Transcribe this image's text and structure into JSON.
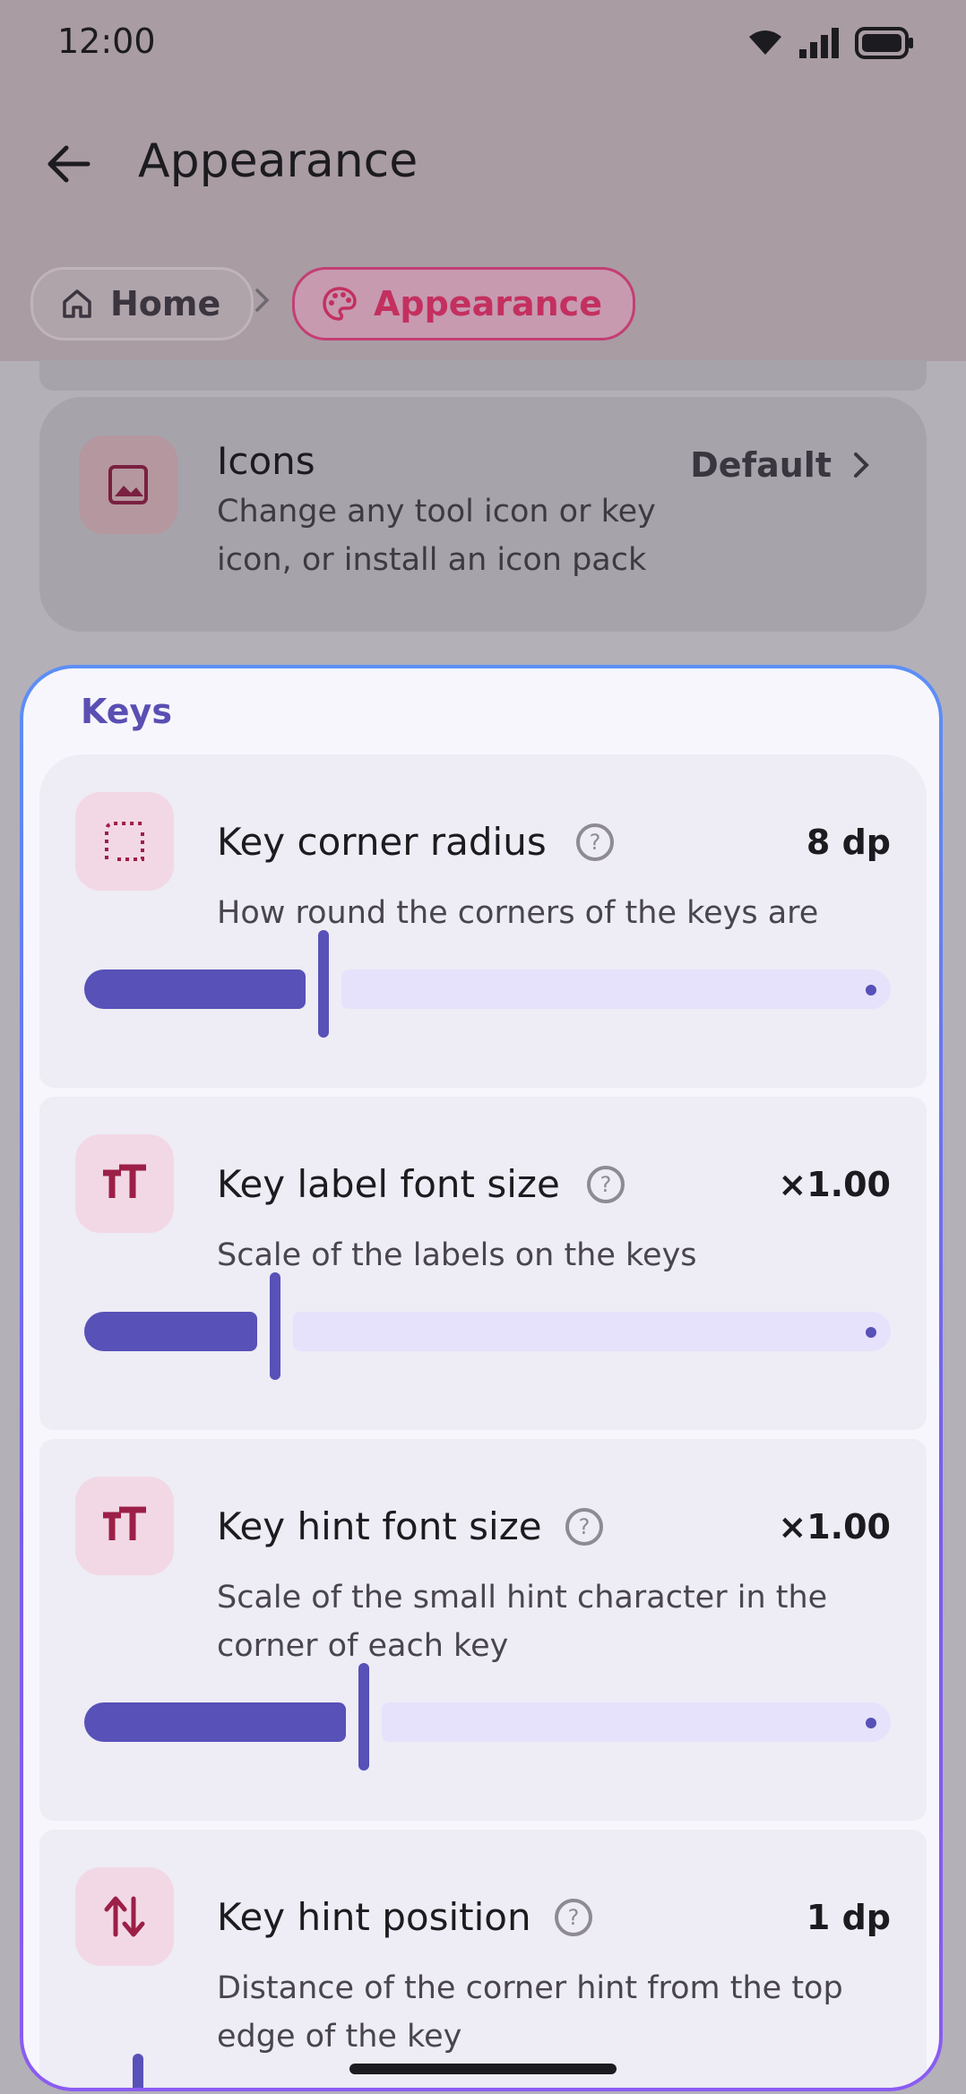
{
  "status_bar": {
    "time": "12:00"
  },
  "app_bar": {
    "title": "Appearance"
  },
  "breadcrumb": {
    "home_label": "Home",
    "current_label": "Appearance"
  },
  "icons_row": {
    "title": "Icons",
    "description": "Change any tool icon or key icon, or install an icon pack",
    "value": "Default"
  },
  "keys_group": {
    "header": "Keys",
    "settings": [
      {
        "title": "Key corner radius",
        "value": "8 dp",
        "description": "How round the corners of the keys are",
        "slider_fraction": 0.29
      },
      {
        "title": "Key label font size",
        "value": "×1.00",
        "description": "Scale of the labels on the keys",
        "slider_fraction": 0.23
      },
      {
        "title": "Key hint font size",
        "value": "×1.00",
        "description": "Scale of the small hint character in the corner of each key",
        "slider_fraction": 0.34
      },
      {
        "title": "Key hint position",
        "value": "1 dp",
        "description": "Distance of the corner hint from the top edge of the key",
        "slider_fraction": 0.06
      }
    ]
  },
  "colors": {
    "accent": "#5751b8",
    "brand_pink": "#c3305f",
    "icon_tint": "#9c1f47"
  },
  "icons": [
    "back-arrow-icon",
    "home-icon",
    "chevron-right-icon",
    "palette-icon",
    "image-icon",
    "corner-radius-icon",
    "font-size-icon",
    "swap-vertical-icon",
    "help-icon"
  ]
}
